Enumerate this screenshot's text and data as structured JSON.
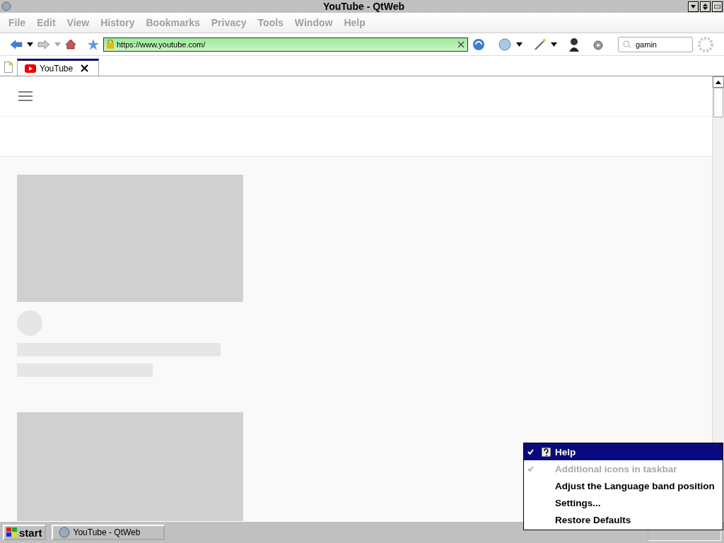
{
  "window": {
    "title": "YouTube - QtWeb"
  },
  "menu_bar": [
    "File",
    "Edit",
    "View",
    "History",
    "Bookmarks",
    "Privacy",
    "Tools",
    "Window",
    "Help"
  ],
  "address_bar": {
    "value": "https://www.youtube.com/",
    "secure": true
  },
  "search": {
    "value": "gamin"
  },
  "tabs": [
    {
      "label": "YouTube",
      "selected": true
    }
  ],
  "page": {
    "cards": [
      {
        "kind": "skeleton"
      },
      {
        "kind": "thumbnail"
      }
    ]
  },
  "context_menu": [
    {
      "label": "Help",
      "checked": true,
      "selected": true,
      "disabled": false,
      "kind": "icon"
    },
    {
      "label": "Additional icons in taskbar",
      "checked": true,
      "selected": false,
      "disabled": true,
      "kind": "plain"
    },
    {
      "label": "Adjust the Language band position",
      "checked": false,
      "selected": false,
      "disabled": false,
      "kind": "plain"
    },
    {
      "label": "Settings...",
      "checked": false,
      "selected": false,
      "disabled": false,
      "kind": "plain"
    },
    {
      "label": "Restore Defaults",
      "checked": false,
      "selected": false,
      "disabled": false,
      "kind": "plain"
    }
  ],
  "taskbar": {
    "start": "start",
    "tasks": [
      {
        "label": "YouTube - QtWeb",
        "selected": false
      }
    ]
  }
}
